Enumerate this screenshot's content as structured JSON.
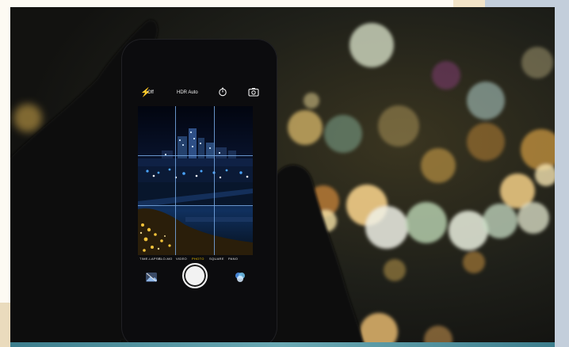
{
  "scene": {
    "subject": "Hands holding a smartphone taking a night photo of a city skyline with bokeh lights",
    "colors": {
      "page_background": "#fdfaf3",
      "right_band": "#c3cedb",
      "frame_dark": "#1a1a17",
      "bokeh_warm": "#f1c27a",
      "bokeh_green": "#bcd6b4",
      "bokeh_white": "#eef0e6",
      "grid_line": "#78aae6",
      "active_mode": "#f0c400",
      "bottom_strip": "#3c7d8c"
    }
  },
  "camera_ui": {
    "flash_label": "Off",
    "hdr_label": "HDR Auto",
    "icons": {
      "flash": "flash-icon",
      "timer": "timer-icon",
      "switch_camera": "switch-camera-icon",
      "shutter": "shutter-button",
      "thumbnail": "photo-thumbnail-icon",
      "filters": "filters-icon"
    },
    "modes": [
      {
        "label": "TIME-LAPSE",
        "active": false
      },
      {
        "label": "SLO-MO",
        "active": false
      },
      {
        "label": "VIDEO",
        "active": false
      },
      {
        "label": "PHOTO",
        "active": true
      },
      {
        "label": "SQUARE",
        "active": false
      },
      {
        "label": "PANO",
        "active": false
      }
    ]
  }
}
